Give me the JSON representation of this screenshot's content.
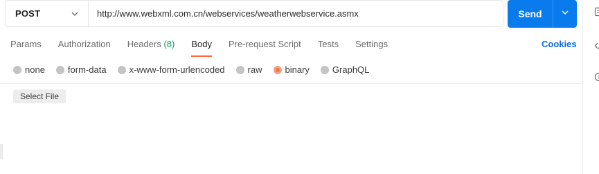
{
  "request": {
    "method": "POST",
    "url": "http://www.webxml.com.cn/webservices/weatherwebservice.asmx"
  },
  "send": {
    "label": "Send"
  },
  "tabs": [
    {
      "label": "Params"
    },
    {
      "label": "Authorization"
    },
    {
      "label": "Headers",
      "count": "(8)"
    },
    {
      "label": "Body",
      "active": true
    },
    {
      "label": "Pre-request Script"
    },
    {
      "label": "Tests"
    },
    {
      "label": "Settings"
    }
  ],
  "cookies_label": "Cookies",
  "body_types": [
    {
      "label": "none"
    },
    {
      "label": "form-data"
    },
    {
      "label": "x-www-form-urlencoded"
    },
    {
      "label": "raw"
    },
    {
      "label": "binary",
      "selected": true
    },
    {
      "label": "GraphQL"
    }
  ],
  "select_file_label": "Select File",
  "colors": {
    "accent": "#ff6c37",
    "send": "#097bed",
    "headers_count": "#0f9d58",
    "cookies": "#0a6cd9"
  },
  "sidebar_icons": [
    "documentation-icon",
    "code-icon",
    "info-icon"
  ]
}
